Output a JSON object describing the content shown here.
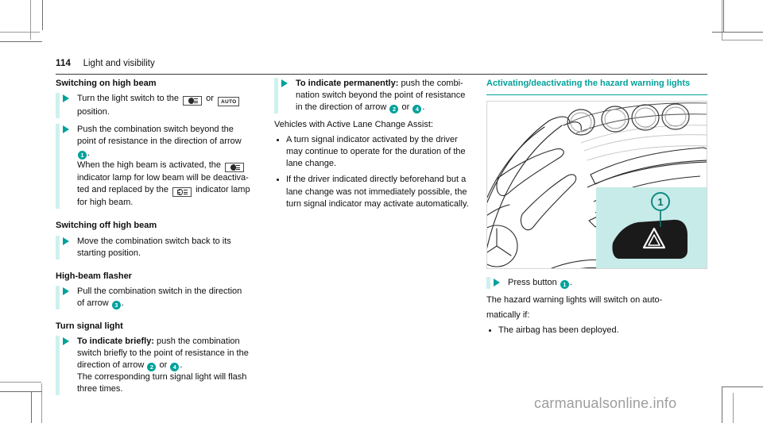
{
  "header": {
    "page_number": "114",
    "chapter": "Light and visibility"
  },
  "column1": {
    "heading_on": "Switching on high beam",
    "step1": {
      "pre": "Turn the light switch to the",
      "icon_lowbeam": "low-beam-icon",
      "or": "or",
      "icon_auto": "AUTO",
      "post": "position."
    },
    "step2": {
      "line1": "Push the combination switch beyond the",
      "line2": "point of resistance in the direction of arrow",
      "badge": "1",
      "period": ".",
      "line3_pre": "When the high beam is activated, the",
      "line3_post": "indicator lamp for low beam will be deactiva-",
      "line4_pre": "ted and replaced by the",
      "line4_post": "indicator lamp",
      "line5": "for high beam."
    },
    "heading_off": "Switching off high beam",
    "step3": {
      "line1": "Move the combination switch back to its",
      "line2": "starting position."
    },
    "heading_flasher": "High-beam flasher",
    "step4": {
      "line1": "Pull the combination switch in the direction",
      "line2_pre": "of arrow",
      "badge": "3",
      "period": "."
    },
    "heading_turn": "Turn signal light",
    "step5": {
      "bold": "To indicate briefly:",
      "rest1": "push the combination",
      "line2": "switch briefly to the point of resistance in the",
      "line3_pre": "direction of arrow",
      "badge_a": "2",
      "or": "or",
      "badge_b": "4",
      "period": ".",
      "line4": "The corresponding turn signal light will flash",
      "line5": "three times."
    }
  },
  "column2": {
    "step1": {
      "bold": "To indicate permanently:",
      "rest1": "push the combi-",
      "line2": "nation switch beyond the point of resistance",
      "line3_pre": "in the direction of arrow",
      "badge_a": "2",
      "or": "or",
      "badge_b": "4",
      "period": "."
    },
    "intro": "Vehicles with Active Lane Change Assist:",
    "bullets": [
      "A turn signal indicator activated by the driver may continue to operate for the duration of the lane change.",
      "If the driver indicated directly beforehand but a lane change was not immediately possible, the turn signal indicator may activate automatically."
    ]
  },
  "column3": {
    "heading": "Activating/deactivating the hazard warning lights",
    "illustration": {
      "name": "dashboard-hazard-button-illustration",
      "callout_badge": "1",
      "hazard_symbol": "warning-triangle-icon"
    },
    "step1": {
      "pre": "Press button",
      "badge": "1",
      "period": "."
    },
    "note_line1": "The hazard warning lights will switch on auto-",
    "note_line2": "matically if:",
    "bullets": [
      "The airbag has been deployed."
    ]
  },
  "watermark": "carmanualsonline.info",
  "colors": {
    "teal": "#00a19a",
    "teal_pale": "#cdf1ef",
    "text": "#0f0f0f",
    "rule": "#3b3b3b",
    "watermark_gray": "#9e9e9e"
  }
}
